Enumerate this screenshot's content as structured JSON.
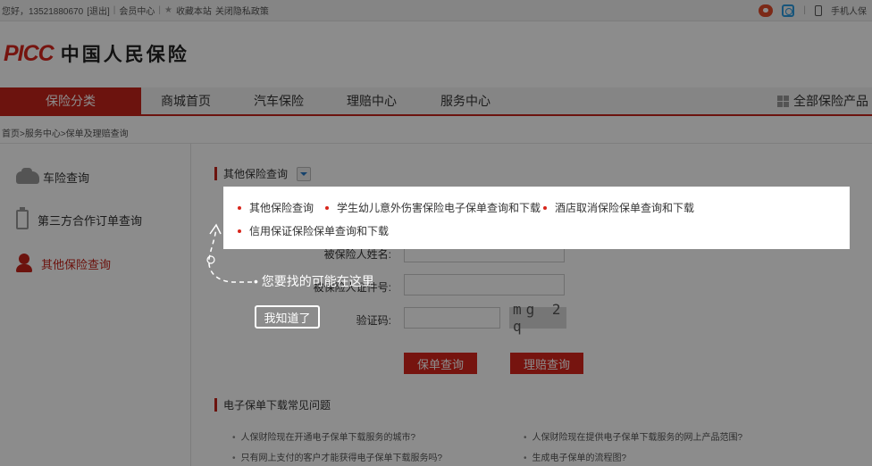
{
  "topbar": {
    "greeting": "您好，13521880670",
    "logout": "[退出]",
    "sep1": "|",
    "member_center": "会员中心",
    "sep2": "|",
    "favorite": "收藏本站",
    "privacy": "关闭隐私政策",
    "sep3": "|",
    "mobile": "手机人保"
  },
  "logo": {
    "brand": "PICC",
    "name": "中国人民保险"
  },
  "nav": {
    "items": [
      "保险分类",
      "商城首页",
      "汽车保险",
      "理赔中心",
      "服务中心"
    ],
    "all_products": "全部保险产品"
  },
  "breadcrumb": "首页>服务中心>保单及理赔查询",
  "sidebar": {
    "items": [
      "车险查询",
      "第三方合作订单查询",
      "其他保险查询"
    ]
  },
  "main": {
    "section_title": "其他保险查询",
    "form": {
      "name_label": "被保险人姓名:",
      "id_label": "被保险人证件号:",
      "captcha_label": "验证码:",
      "captcha_text": "mg 2 q"
    },
    "policy_query_button": "保单查询",
    "claim_query_button": "理赔查询",
    "faq_title": "电子保单下载常见问题",
    "faq": [
      "人保财险现在开通电子保单下载服务的城市?",
      "人保财险现在提供电子保单下载服务的网上产品范围?",
      "只有网上支付的客户才能获得电子保单下载服务吗?",
      "生成电子保单的流程图?"
    ]
  },
  "popup": {
    "options": [
      "其他保险查询",
      "学生幼儿意外伤害保险电子保单查询和下载",
      "酒店取消保险保单查询和下载",
      "信用保证保险保单查询和下载"
    ]
  },
  "guide": {
    "hint": "您要找的可能在这里",
    "got_it": "我知道了"
  },
  "colors": {
    "brand_red": "#c5241b",
    "overlay": "rgba(0,0,0,0.45)"
  }
}
